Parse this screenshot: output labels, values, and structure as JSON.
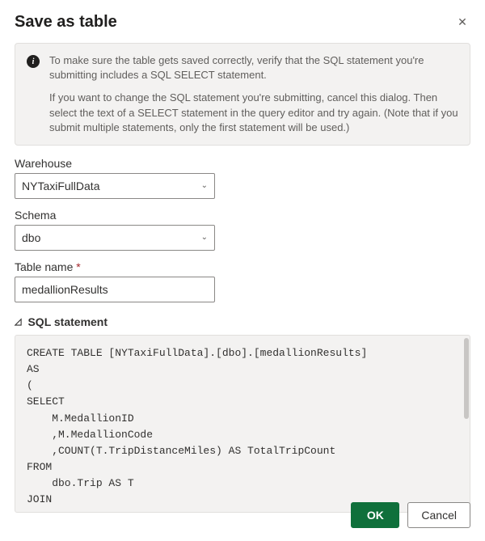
{
  "dialog": {
    "title": "Save as table"
  },
  "info": {
    "p1": "To make sure the table gets saved correctly, verify that the SQL statement you're submitting includes a SQL SELECT statement.",
    "p2": "If you want to change the SQL statement you're submitting, cancel this dialog. Then select the text of a SELECT statement in the query editor and try again. (Note that if you submit multiple statements, only the first statement will be used.)"
  },
  "fields": {
    "warehouse": {
      "label": "Warehouse",
      "value": "NYTaxiFullData"
    },
    "schema": {
      "label": "Schema",
      "value": "dbo"
    },
    "tablename": {
      "label": "Table name",
      "value": "medallionResults"
    }
  },
  "sql": {
    "heading": "SQL statement",
    "code": "CREATE TABLE [NYTaxiFullData].[dbo].[medallionResults]\nAS\n(\nSELECT\n    M.MedallionID\n    ,M.MedallionCode\n    ,COUNT(T.TripDistanceMiles) AS TotalTripCount\nFROM\n    dbo.Trip AS T\nJOIN"
  },
  "buttons": {
    "ok": "OK",
    "cancel": "Cancel"
  }
}
